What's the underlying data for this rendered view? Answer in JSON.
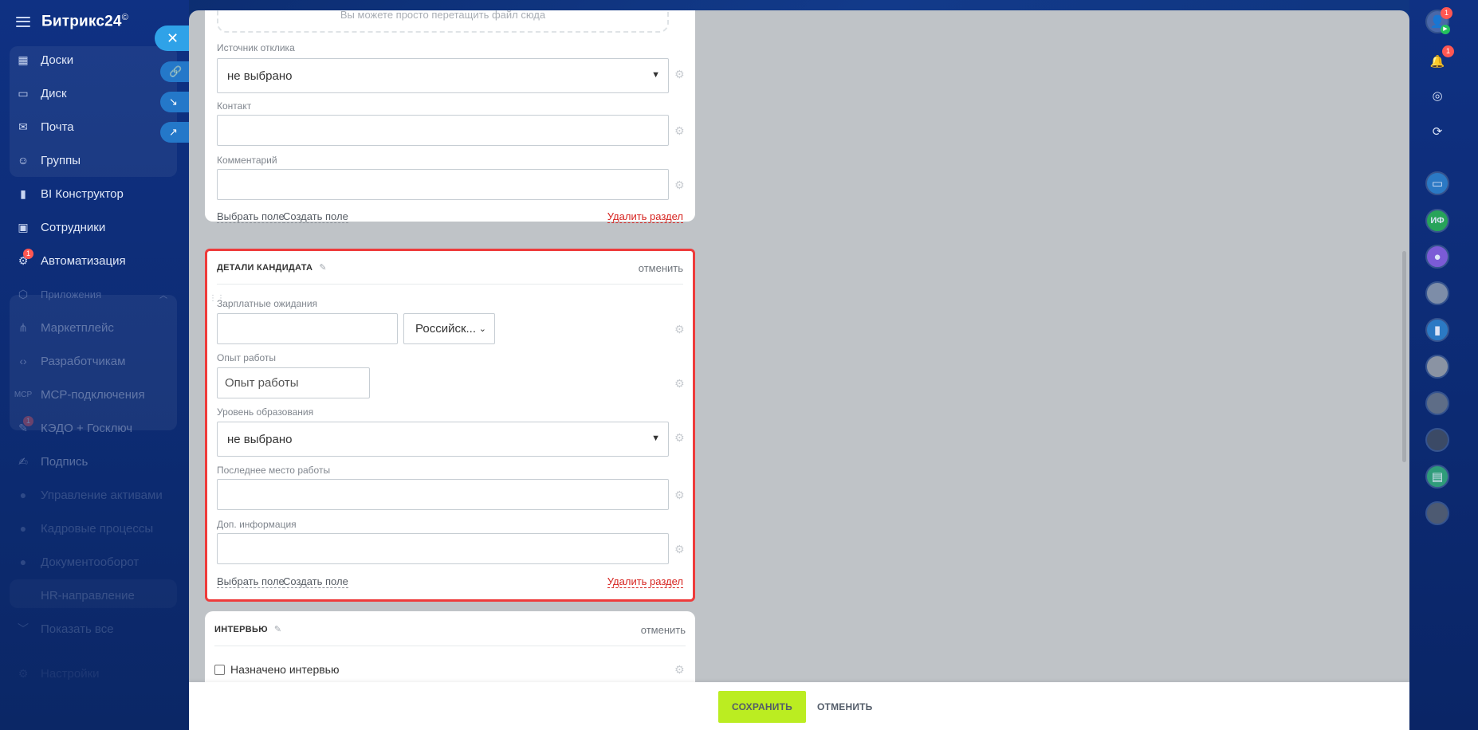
{
  "app": {
    "logo_text": "Битрикс24",
    "logo_mark": "©"
  },
  "sidebar": {
    "items": [
      {
        "label": "Доски",
        "icon": "board-icon"
      },
      {
        "label": "Диск",
        "icon": "disk-icon"
      },
      {
        "label": "Почта",
        "icon": "mail-icon"
      },
      {
        "label": "Группы",
        "icon": "groups-icon"
      },
      {
        "label": "BI Конструктор",
        "icon": "bi-icon"
      },
      {
        "label": "Сотрудники",
        "icon": "employees-icon"
      },
      {
        "label": "Автоматизация",
        "icon": "automation-icon",
        "badge": "1"
      },
      {
        "label": "Приложения",
        "icon": "apps-icon"
      },
      {
        "label": "Маркетплейс",
        "icon": "marketplace-icon"
      },
      {
        "label": "Разработчикам",
        "icon": "code-icon"
      },
      {
        "label": "MCP-подключения",
        "icon": "mcp-icon"
      },
      {
        "label": "КЭДО + Госключ",
        "icon": "kedo-icon",
        "badge": "1"
      },
      {
        "label": "Подпись",
        "icon": "sign-icon"
      },
      {
        "label": "Управление активами",
        "icon": "assets-icon"
      },
      {
        "label": "Кадровые процессы",
        "icon": "hr-icon"
      },
      {
        "label": "Документооборот",
        "icon": "docflow-icon"
      },
      {
        "label": "HR-направление",
        "icon": "hr-direction-icon"
      },
      {
        "label": "Показать все",
        "icon": "chevron-down-icon"
      },
      {
        "label": "Настройки",
        "icon": "settings-icon"
      }
    ]
  },
  "top_card": {
    "dropzone_text": "Вы можете просто перетащить файл сюда",
    "fields": [
      {
        "label": "Источник отклика",
        "value": "не выбрано",
        "type": "select"
      },
      {
        "label": "Контакт",
        "value": "",
        "type": "text"
      },
      {
        "label": "Комментарий",
        "value": "",
        "type": "text"
      }
    ],
    "choose_field": "Выбрать поле",
    "create_field": "Создать поле",
    "delete_section": "Удалить раздел"
  },
  "detail_card": {
    "title": "ДЕТАЛИ КАНДИДАТА",
    "cancel": "отменить",
    "salary_label": "Зарплатные ожидания",
    "salary_value": "",
    "currency_value": "Российск...",
    "experience_label": "Опыт работы",
    "experience_placeholder": "Опыт работы",
    "education_label": "Уровень образования",
    "education_value": "не выбрано",
    "last_job_label": "Последнее место работы",
    "last_job_value": "",
    "extra_label": "Доп. информация",
    "extra_value": "",
    "choose_field": "Выбрать поле",
    "create_field": "Создать поле",
    "delete_section": "Удалить раздел"
  },
  "interview_card": {
    "title": "ИНТЕРВЬЮ",
    "cancel": "отменить",
    "checkbox_label": "Назначено интервью"
  },
  "bottom_bar": {
    "save": "СОХРАНИТЬ",
    "cancel": "ОТМЕНИТЬ"
  },
  "right_bar": {
    "profile_badge": "1",
    "notifications_badge": "1",
    "initials_chat": "ИФ"
  },
  "colors": {
    "accent_save": "#bbed21",
    "highlight_border": "#ee3b3b",
    "delete_link": "#d6231f",
    "sidebar_bg": "#0f3183"
  }
}
